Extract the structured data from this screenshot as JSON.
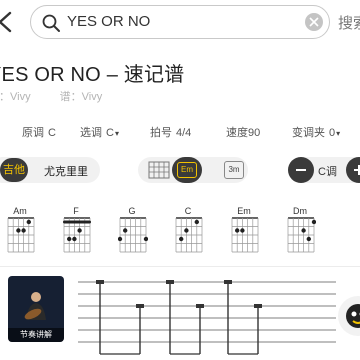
{
  "search": {
    "query": "YES OR NO",
    "placeholder": "",
    "button_label": "搜索"
  },
  "song": {
    "title": "YES OR NO – 速记谱",
    "meta": {
      "artist": "词：Vivy",
      "composer": "谱：Vivy"
    }
  },
  "settings": [
    {
      "label": "原调",
      "value": "C",
      "caret": ""
    },
    {
      "label": "选调",
      "value": "C",
      "caret": "▾"
    },
    {
      "label": "拍号",
      "value": "4/4",
      "caret": ""
    },
    {
      "label": "速度",
      "value": "90",
      "caret": ""
    },
    {
      "label": "变调夹",
      "value": "0",
      "caret": "▾"
    }
  ],
  "controls": {
    "instrument_active": "吉他",
    "instrument_other": "尤克里里",
    "chord_view_active": "Em",
    "chord_view_other": "3m",
    "key_label": "C调"
  },
  "chords": [
    "Am",
    "F",
    "G",
    "C",
    "Em",
    "Dm"
  ],
  "video": {
    "label": "节奏讲解"
  },
  "colors": {
    "accent": "#f2c200",
    "dark": "#3a3a3a",
    "muted": "#b4b4b4"
  }
}
